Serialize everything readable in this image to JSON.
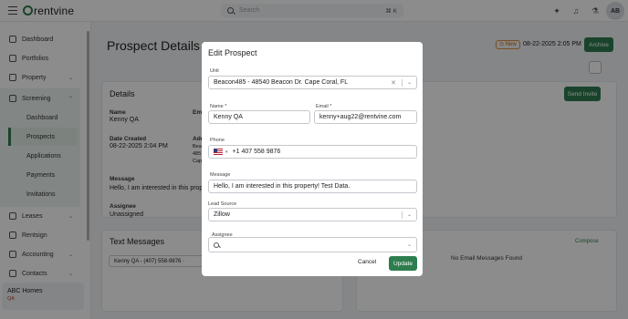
{
  "topbar": {
    "logo_text": "rentvine",
    "search_placeholder": "Search",
    "search_shortcut": "⌘ K",
    "avatar_initials": "AB",
    "icons": [
      "menu-icon",
      "sparkle-icon",
      "bell-icon",
      "flask-icon"
    ]
  },
  "sidebar": {
    "items": [
      {
        "label": "Dashboard",
        "icon": "grid-icon"
      },
      {
        "label": "Portfolios",
        "icon": "folder-icon"
      },
      {
        "label": "Property",
        "icon": "home-icon"
      },
      {
        "label": "Screening",
        "icon": "clipboard-icon"
      },
      {
        "label": "Leases",
        "icon": "document-icon"
      },
      {
        "label": "Rentsign",
        "icon": "pen-icon"
      },
      {
        "label": "Accounting",
        "icon": "dollar-icon"
      },
      {
        "label": "Contacts",
        "icon": "contacts-icon"
      }
    ],
    "screening_sub": [
      {
        "label": "Dashboard"
      },
      {
        "label": "Prospects"
      },
      {
        "label": "Applications"
      },
      {
        "label": "Payments"
      },
      {
        "label": "Invitations"
      }
    ],
    "company": {
      "name": "ABC Homes",
      "tag": "QA"
    }
  },
  "page": {
    "title": "Prospect Details",
    "status_badge": "New",
    "date": "08-22-2025 2:05 PM",
    "archive_label": "Archive",
    "details": {
      "heading": "Details",
      "send_invite": "Send Invite",
      "name_label": "Name",
      "name_value": "Kenny QA",
      "email_label_fragment": "Em",
      "date_created_label": "Date Created",
      "date_created_value": "08-22-2025 2:04 PM",
      "address_label_fragment": "Add",
      "address_value_fragments": [
        "Bea",
        "485",
        "Cap"
      ],
      "message_label": "Message",
      "message_value": "Hello, I am interested in this prop",
      "assignee_label": "Assignee",
      "assignee_value": "Unassigned"
    },
    "text_messages": {
      "heading": "Text Messages",
      "chip": "Kenny QA - (407) 558-9876 ·"
    },
    "emails": {
      "compose": "Compose",
      "empty": "No Email Messages Found"
    }
  },
  "modal": {
    "title": "Edit Prospect",
    "unit_label": "Unit",
    "unit_value": "Beacon485 - 48540 Beacon Dr. Cape Coral, FL",
    "name_label": "Name *",
    "name_value": "Kenny QA",
    "email_label": "Email *",
    "email_value": "kenny+aug22@rentvine.com",
    "phone_label": "Phone",
    "phone_value": "+1 407 558 9876",
    "message_label": "Message",
    "message_value": "Hello, I am interested in this property! Test Data.",
    "lead_source_label": "Lead Source",
    "lead_source_value": "Zillow",
    "assignee_label": "Assignee",
    "cancel_label": "Cancel",
    "update_label": "Update"
  }
}
